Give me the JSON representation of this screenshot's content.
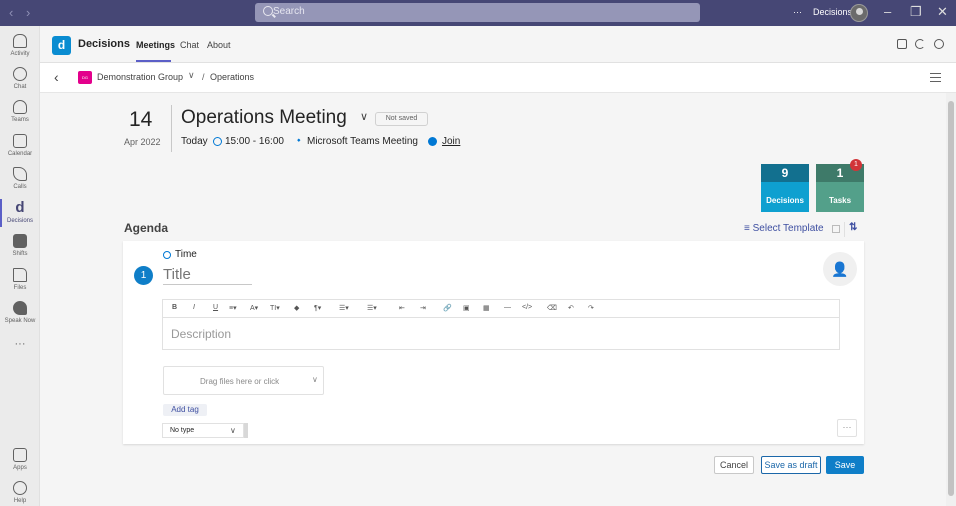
{
  "topbar": {
    "nav_back": "‹",
    "nav_forward": "›",
    "search_placeholder": "Search",
    "more": "···",
    "app_name": "Decisions",
    "window_controls": [
      "–",
      "❐",
      "✕"
    ]
  },
  "rail": [
    {
      "label": "Activity",
      "icon": "bell-icon"
    },
    {
      "label": "Chat",
      "icon": "chat-icon"
    },
    {
      "label": "Teams",
      "icon": "teams-icon"
    },
    {
      "label": "Calendar",
      "icon": "calendar-icon"
    },
    {
      "label": "Calls",
      "icon": "phone-icon"
    },
    {
      "label": "Decisions",
      "icon": "decisions-icon",
      "active": true,
      "glyph": "d"
    },
    {
      "label": "Shifts",
      "icon": "shifts-icon"
    },
    {
      "label": "Files",
      "icon": "file-icon"
    },
    {
      "label": "Speak Now",
      "icon": "speak-icon"
    },
    {
      "label": "···",
      "icon": "more-icon"
    },
    {
      "label": "Apps",
      "icon": "apps-icon"
    },
    {
      "label": "Help",
      "icon": "help-icon"
    }
  ],
  "header": {
    "logo_glyph": "d",
    "app_title": "Decisions",
    "tabs": [
      "Meetings",
      "Chat",
      "About"
    ]
  },
  "breadcrumb": {
    "group_initials": "DG",
    "group": "Demonstration Group",
    "chevron": "∨",
    "separator": "/",
    "current": "Operations"
  },
  "meeting": {
    "day": "14",
    "month_year": "Apr 2022",
    "title": "Operations Meeting",
    "title_chevron": "∨",
    "status": "Not saved",
    "date_label": "Today",
    "time_range": "15:00 - 16:00",
    "location": "Microsoft Teams Meeting",
    "join_label": "Join"
  },
  "tiles": [
    {
      "count": "9",
      "label": "Decisions",
      "color": "#12708f"
    },
    {
      "count": "1",
      "label": "Tasks",
      "color": "#3e7a69",
      "badge": "1"
    }
  ],
  "agenda": {
    "heading": "Agenda",
    "template_label": "Select Template",
    "item": {
      "number": "1",
      "time_label": "Time",
      "title_placeholder": "Title",
      "description_placeholder": "Description",
      "drop_text": "Drag files here or click",
      "add_tag": "Add tag",
      "type_value": "No type",
      "more": "···"
    }
  },
  "toolbar_tools": [
    "B",
    "I",
    "U",
    "≡▾",
    "A▾",
    "TI▾",
    "◆",
    "¶▾",
    "☰▾",
    "☰▾",
    "⇤",
    "⇥",
    "🔗",
    "▣",
    "▦",
    "—",
    "</>",
    "⌫",
    "↶",
    "↷"
  ],
  "footer": {
    "cancel": "Cancel",
    "save_draft": "Save as draft",
    "save": "Save"
  },
  "colors": {
    "topbar": "#464775",
    "accent": "#5b5fc7",
    "primary": "#0f7ec8",
    "decisions_tile": "#0ea0d0",
    "tasks_tile": "#53a08a",
    "badge": "#d13438"
  }
}
